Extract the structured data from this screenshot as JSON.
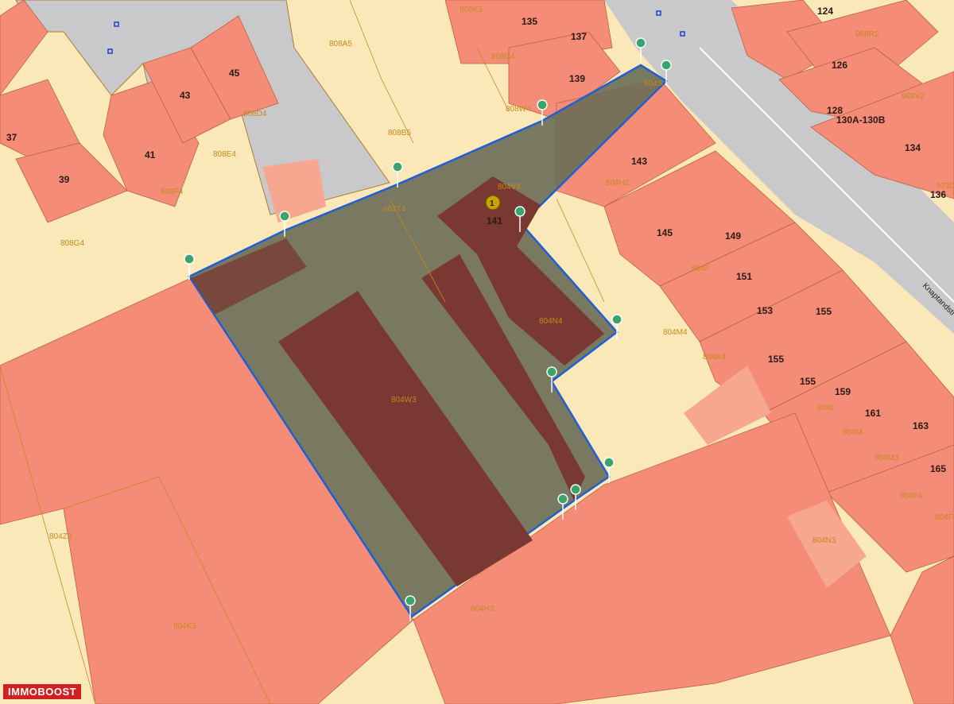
{
  "house_numbers": [
    "124",
    "135",
    "137",
    "126",
    "968R2",
    "45",
    "43",
    "139",
    "128",
    "130A-130B",
    "37",
    "41",
    "39",
    "143",
    "134",
    "136",
    "141",
    "145",
    "149",
    "151",
    "153",
    "155",
    "155",
    "155",
    "159",
    "161",
    "163",
    "165"
  ],
  "parcel_ids": [
    "808K3",
    "808A5",
    "808C4",
    "808W4",
    "808D4",
    "808B5",
    "808E4",
    "808F4",
    "808G4",
    "804T4",
    "804V4",
    "804S",
    "804H2",
    "804F",
    "804N4",
    "804M4",
    "804K4",
    "804W3",
    "804L",
    "804M",
    "804M3",
    "804F4",
    "804N3",
    "804Z3",
    "804K3",
    "804H3",
    "968V2",
    "973D",
    "804F"
  ],
  "street_name": "Knaptandstr",
  "marker_label": "1",
  "brand": "IMMOBOOST",
  "colors": {
    "parcel_fill": "#fbe8b8",
    "building_fill": "#f58c78",
    "road_fill": "#c9c9cb",
    "selection_fill": "#6e6e58",
    "selection_outline": "#1e5fd6",
    "selected_building": "#7a3832",
    "pin_color": "#3aa56b",
    "marker_color": "#c9a400"
  }
}
